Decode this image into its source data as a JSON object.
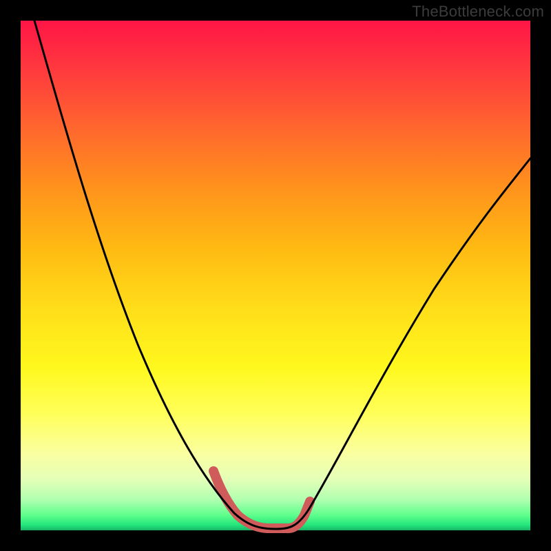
{
  "watermark": "TheBottleneck.com",
  "colors": {
    "background": "#000000",
    "gradient_top": "#ff1546",
    "gradient_bottom": "#1bb366",
    "curve": "#000000",
    "highlight": "#cf5b5b"
  },
  "chart_data": {
    "type": "line",
    "title": "",
    "xlabel": "",
    "ylabel": "",
    "xlim": [
      0,
      100
    ],
    "ylim": [
      0,
      100
    ],
    "grid": false,
    "note": "Bottleneck V-curve. Axes have no tick labels; x is an implicit parameter index (0-100 left→right), y is bottleneck percentage (0 at bottom = no bottleneck, 100 at top = full bottleneck). Values estimated from pixel positions.",
    "series": [
      {
        "name": "bottleneck-curve",
        "x": [
          0,
          5,
          10,
          15,
          20,
          25,
          30,
          35,
          38,
          41,
          44,
          47,
          50,
          53,
          56,
          60,
          65,
          70,
          75,
          80,
          85,
          90,
          95,
          100
        ],
        "y": [
          100,
          90,
          79,
          67,
          55,
          43,
          31,
          19,
          12,
          6,
          3,
          1,
          0,
          1,
          4,
          10,
          19,
          29,
          38,
          47,
          55,
          62,
          68,
          73
        ]
      }
    ],
    "highlight_region": {
      "name": "optimal-zone",
      "x_range": [
        37,
        55
      ],
      "description": "Thick salmon stroke overlaid on the trough of the curve marking the optimal (lowest-bottleneck) region."
    }
  }
}
